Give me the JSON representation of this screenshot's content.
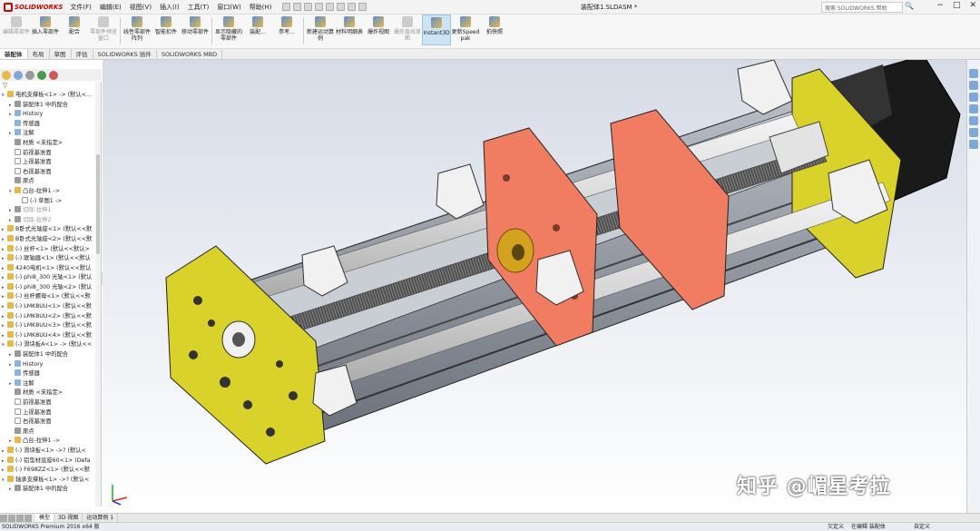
{
  "app": {
    "name": "SOLIDWORKS",
    "doc_title": "装配体1.SLDASM *",
    "search_placeholder": "搜索 SOLIDWORKS 帮助",
    "window_controls": [
      "−",
      "□",
      "✕"
    ],
    "search_icon": "🔍"
  },
  "menu": [
    "文件(F)",
    "编辑(E)",
    "视图(V)",
    "插入(I)",
    "工具(T)",
    "窗口(W)",
    "帮助(H)"
  ],
  "toolbar": [
    {
      "label": "编辑零部件",
      "disabled": true
    },
    {
      "label": "插入零部件",
      "disabled": false
    },
    {
      "label": "配合",
      "disabled": false
    },
    {
      "label": "零部件预览窗口",
      "disabled": true
    },
    {
      "label": "线性零部件阵列",
      "disabled": false
    },
    {
      "label": "智能扣件",
      "disabled": false
    },
    {
      "label": "移动零部件",
      "disabled": false
    },
    {
      "label": "显示隐藏的零部件",
      "disabled": false
    },
    {
      "label": "装配...",
      "disabled": false
    },
    {
      "label": "参考...",
      "disabled": false
    },
    {
      "label": "新建运动算例",
      "disabled": false
    },
    {
      "label": "材料明细表",
      "disabled": false
    },
    {
      "label": "爆炸视图",
      "disabled": false
    },
    {
      "label": "爆炸直线草图",
      "disabled": true
    },
    {
      "label": "Instant3D",
      "disabled": false,
      "active": true
    },
    {
      "label": "更新Speedpak",
      "disabled": false
    },
    {
      "label": "拍快照",
      "disabled": false
    }
  ],
  "command_tabs": [
    "装配体",
    "布局",
    "草图",
    "评估",
    "SOLIDWORKS 插件",
    "SOLIDWORKS MBD"
  ],
  "tree": [
    {
      "t": "电机支撑板<1> -> (默认<...",
      "ar": "▾",
      "ic": "y",
      "lv": 0
    },
    {
      "t": "装配体1 中的配合",
      "ar": "▸",
      "ic": "g",
      "lv": 1
    },
    {
      "t": "History",
      "ar": "▸",
      "ic": "b",
      "lv": 1
    },
    {
      "t": "传感器",
      "ar": "",
      "ic": "b",
      "lv": 1
    },
    {
      "t": "注解",
      "ar": "▸",
      "ic": "b",
      "lv": 1
    },
    {
      "t": "材质 <未指定>",
      "ar": "",
      "ic": "g",
      "lv": 1
    },
    {
      "t": "前视基准面",
      "ar": "",
      "ic": "w",
      "lv": 1
    },
    {
      "t": "上视基准面",
      "ar": "",
      "ic": "w",
      "lv": 1
    },
    {
      "t": "右视基准面",
      "ar": "",
      "ic": "w",
      "lv": 1
    },
    {
      "t": "原点",
      "ar": "",
      "ic": "g",
      "lv": 1
    },
    {
      "t": "凸台-拉伸1 ->",
      "ar": "▾",
      "ic": "y",
      "lv": 1
    },
    {
      "t": "(-) 草图1 ->",
      "ar": "",
      "ic": "w",
      "lv": 2
    },
    {
      "t": "切除-拉伸1",
      "ar": "▸",
      "ic": "g",
      "lv": 1,
      "muted": true
    },
    {
      "t": "切除-拉伸2",
      "ar": "▸",
      "ic": "g",
      "lv": 1,
      "muted": true
    },
    {
      "t": "B卧式光轴座<1> (默认<<默",
      "ar": "▸",
      "ic": "y",
      "lv": 0
    },
    {
      "t": "B卧式光轴座<2> (默认<<默",
      "ar": "▸",
      "ic": "y",
      "lv": 0
    },
    {
      "t": "(-) 丝杆<1> (默认<<默认>",
      "ar": "▸",
      "ic": "y",
      "lv": 0
    },
    {
      "t": "(-) 联轴器<1> (默认<<默认",
      "ar": "▸",
      "ic": "y",
      "lv": 0
    },
    {
      "t": "4240电机<1> (默认<<默认",
      "ar": "▸",
      "ic": "y",
      "lv": 0
    },
    {
      "t": "(-) phi8_300 光轴<1> (默认",
      "ar": "▸",
      "ic": "y",
      "lv": 0
    },
    {
      "t": "(-) phi8_300 光轴<2> (默认",
      "ar": "▸",
      "ic": "y",
      "lv": 0
    },
    {
      "t": "(-) 丝杆螺母<1> (默认<<默",
      "ar": "▸",
      "ic": "y",
      "lv": 0
    },
    {
      "t": "(-) LMK8UU<1> (默认<<默",
      "ar": "▸",
      "ic": "y",
      "lv": 0
    },
    {
      "t": "(-) LMK8UU<2> (默认<<默",
      "ar": "▸",
      "ic": "y",
      "lv": 0
    },
    {
      "t": "(-) LMK8UU<3> (默认<<默",
      "ar": "▸",
      "ic": "y",
      "lv": 0
    },
    {
      "t": "(-) LMK8UU<4> (默认<<默",
      "ar": "▸",
      "ic": "y",
      "lv": 0
    },
    {
      "t": "(-) 滑块板A<1> -> (默认<<",
      "ar": "▾",
      "ic": "y",
      "lv": 0
    },
    {
      "t": "装配体1 中的配合",
      "ar": "▸",
      "ic": "g",
      "lv": 1
    },
    {
      "t": "History",
      "ar": "▸",
      "ic": "b",
      "lv": 1
    },
    {
      "t": "传感器",
      "ar": "",
      "ic": "b",
      "lv": 1
    },
    {
      "t": "注解",
      "ar": "▸",
      "ic": "b",
      "lv": 1
    },
    {
      "t": "材质 <未指定>",
      "ar": "",
      "ic": "g",
      "lv": 1
    },
    {
      "t": "前视基准面",
      "ar": "",
      "ic": "w",
      "lv": 1
    },
    {
      "t": "上视基准面",
      "ar": "",
      "ic": "w",
      "lv": 1
    },
    {
      "t": "右视基准面",
      "ar": "",
      "ic": "w",
      "lv": 1
    },
    {
      "t": "原点",
      "ar": "",
      "ic": "g",
      "lv": 1
    },
    {
      "t": "凸台-拉伸1 ->",
      "ar": "▸",
      "ic": "y",
      "lv": 1
    },
    {
      "t": "(-) 滑块板<1> ->? (默认<",
      "ar": "▸",
      "ic": "y",
      "lv": 0
    },
    {
      "t": "(-) 铝型材底座60<1> (Defa",
      "ar": "▸",
      "ic": "y",
      "lv": 0
    },
    {
      "t": "(-) F698ZZ<1> (默认<<默",
      "ar": "▸",
      "ic": "y",
      "lv": 0
    },
    {
      "t": "轴承支撑板<1> ->? (默认<",
      "ar": "▾",
      "ic": "y",
      "lv": 0
    },
    {
      "t": "装配体1 中的配合",
      "ar": "▸",
      "ic": "g",
      "lv": 1
    }
  ],
  "bottom_tabs": [
    "模型",
    "3D 视图",
    "运动算例 1"
  ],
  "status": {
    "left": "SOLIDWORKS Premium 2016 x64 版",
    "m1": "欠定义",
    "m2": "在编辑 装配体",
    "m3": "自定义"
  },
  "watermark": "知乎 @嵋星考拉",
  "colors": {
    "accent": "#1f6fbf",
    "yellow_plate": "#d8d22a",
    "salmon_plate": "#f07c62",
    "rail": "#8a9098",
    "background_top": "#d6dbe6"
  }
}
